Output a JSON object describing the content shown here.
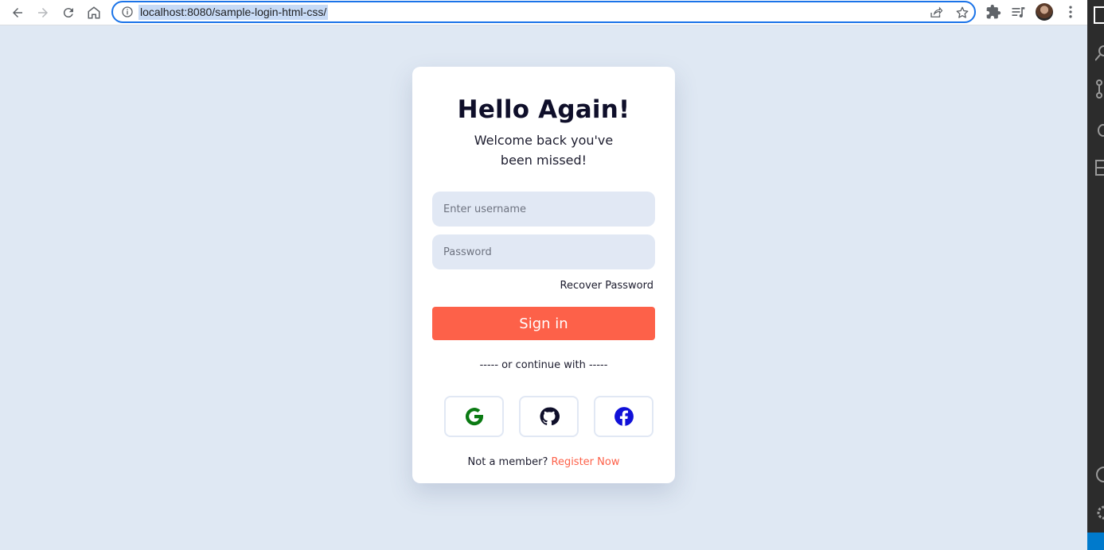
{
  "browser": {
    "url": "localhost:8080/sample-login-html-css/",
    "icons": [
      "back-icon",
      "forward-icon",
      "reload-icon",
      "home-icon",
      "info-icon",
      "share-icon",
      "star-icon",
      "extensions-icon",
      "reading-list-icon",
      "profile-avatar",
      "menu-icon"
    ]
  },
  "login": {
    "title": "Hello Again!",
    "subtitle": "Welcome back you've been missed!",
    "username_placeholder": "Enter username",
    "password_placeholder": "Password",
    "recover_label": "Recover Password",
    "signin_label": "Sign in",
    "divider_text": "----- or continue with -----",
    "social": [
      {
        "name": "google",
        "icon": "google-icon",
        "color": "#0a7a12"
      },
      {
        "name": "github",
        "icon": "github-icon",
        "color": "#0f0f2a"
      },
      {
        "name": "facebook",
        "icon": "facebook-icon",
        "color": "#1010d8"
      }
    ],
    "footer_text": "Not a member?",
    "register_label": "Register Now"
  },
  "colors": {
    "page_bg": "#dfe8f3",
    "accent": "#fd6149",
    "field_bg": "#e1e8f4"
  }
}
